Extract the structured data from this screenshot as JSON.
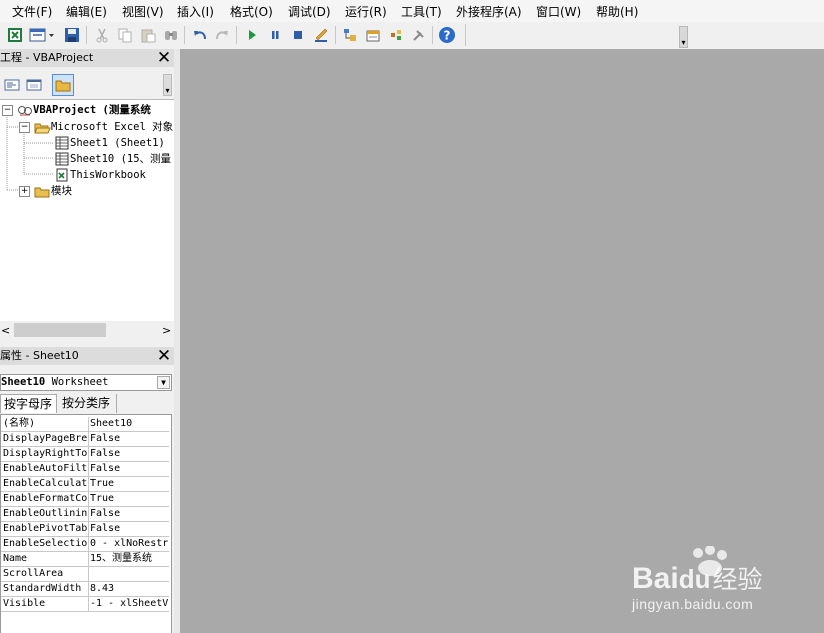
{
  "menu": [
    "文件(F)",
    "编辑(E)",
    "视图(V)",
    "插入(I)",
    "格式(O)",
    "调试(D)",
    "运行(R)",
    "工具(T)",
    "外接程序(A)",
    "窗口(W)",
    "帮助(H)"
  ],
  "project_pane": {
    "title": "工程 - VBAProject",
    "close": "✕",
    "tree": {
      "root": "VBAProject (测量系统",
      "excel_objects": "Microsoft Excel 对象",
      "sheet1": "Sheet1 (Sheet1)",
      "sheet10": "Sheet10 (15、测量",
      "workbook": "ThisWorkbook",
      "modules": "模块"
    }
  },
  "properties_pane": {
    "title": "属性 - Sheet10",
    "close": "✕",
    "object_name": "Sheet10",
    "object_type": "Worksheet",
    "tabs": [
      "按字母序",
      "按分类序"
    ],
    "rows": [
      {
        "name": "(名称)",
        "value": "Sheet10"
      },
      {
        "name": "DisplayPageBre",
        "value": "False"
      },
      {
        "name": "DisplayRightTo",
        "value": "False"
      },
      {
        "name": "EnableAutoFilt",
        "value": "False"
      },
      {
        "name": "EnableCalculat",
        "value": "True"
      },
      {
        "name": "EnableFormatCo",
        "value": "True"
      },
      {
        "name": "EnableOutlinin",
        "value": "False"
      },
      {
        "name": "EnablePivotTab",
        "value": "False"
      },
      {
        "name": "EnableSelectio",
        "value": "0 - xlNoRestr"
      },
      {
        "name": "Name",
        "value": "15、测量系统"
      },
      {
        "name": "ScrollArea",
        "value": ""
      },
      {
        "name": "StandardWidth",
        "value": "8.43"
      },
      {
        "name": "Visible",
        "value": "-1 - xlSheetV"
      }
    ]
  },
  "watermark": {
    "brand": "Bai",
    "brand2": "du",
    "site": "经验",
    "url": "jingyan.baidu.com"
  },
  "colors": {
    "workspace": "#a9a9a9",
    "title_bar": "#dcdcdc",
    "play": "#1a9a3a",
    "help": "#2a6ac8"
  }
}
